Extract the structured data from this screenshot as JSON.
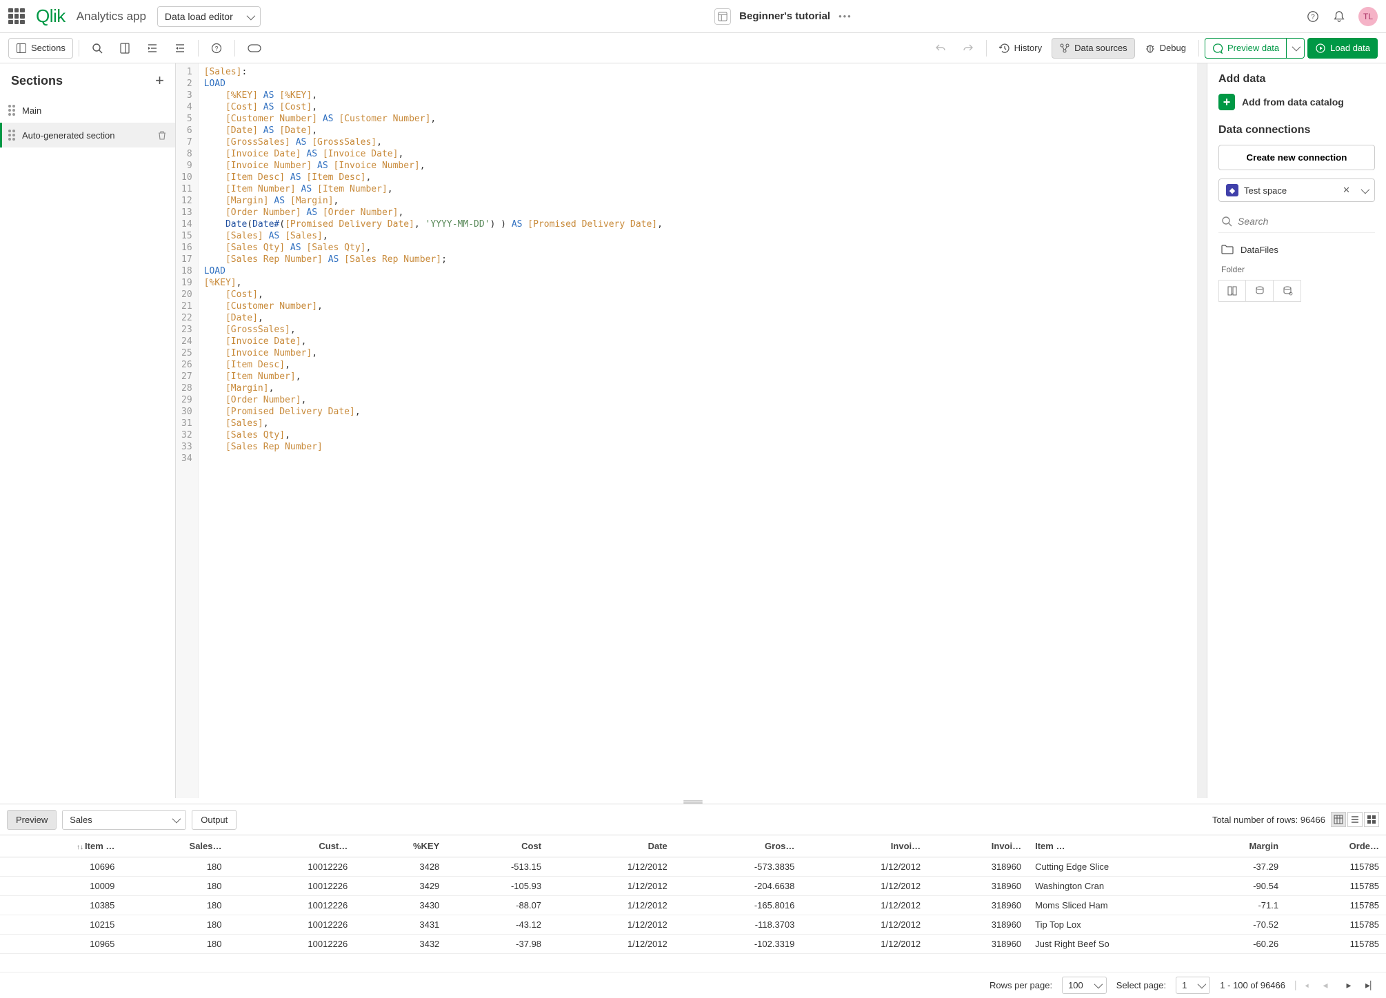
{
  "header": {
    "logo": "Qlik",
    "app_name": "Analytics app",
    "mode": "Data load editor",
    "doc_title": "Beginner's tutorial",
    "avatar_initials": "TL"
  },
  "toolbar": {
    "sections": "Sections",
    "history": "History",
    "data_sources": "Data sources",
    "debug": "Debug",
    "preview_data": "Preview data",
    "load_data": "Load data"
  },
  "sections": {
    "heading": "Sections",
    "items": [
      {
        "label": "Main",
        "selected": false
      },
      {
        "label": "Auto-generated section",
        "selected": true
      }
    ]
  },
  "editor": {
    "lines": [
      {
        "n": 1,
        "html": "<span class='t-orange'>[Sales]</span>:"
      },
      {
        "n": 2,
        "html": "<span class='t-blue'>LOAD</span>"
      },
      {
        "n": 3,
        "html": "    <span class='t-orange'>[%KEY]</span> <span class='t-blue'>AS</span> <span class='t-orange'>[%KEY]</span>,"
      },
      {
        "n": 4,
        "html": "    <span class='t-orange'>[Cost]</span> <span class='t-blue'>AS</span> <span class='t-orange'>[Cost]</span>,"
      },
      {
        "n": 5,
        "html": "    <span class='t-orange'>[Customer Number]</span> <span class='t-blue'>AS</span> <span class='t-orange'>[Customer Number]</span>,"
      },
      {
        "n": 6,
        "html": "    <span class='t-orange'>[Date]</span> <span class='t-blue'>AS</span> <span class='t-orange'>[Date]</span>,"
      },
      {
        "n": 7,
        "html": "    <span class='t-orange'>[GrossSales]</span> <span class='t-blue'>AS</span> <span class='t-orange'>[GrossSales]</span>,"
      },
      {
        "n": 8,
        "html": "    <span class='t-orange'>[Invoice Date]</span> <span class='t-blue'>AS</span> <span class='t-orange'>[Invoice Date]</span>,"
      },
      {
        "n": 9,
        "html": "    <span class='t-orange'>[Invoice Number]</span> <span class='t-blue'>AS</span> <span class='t-orange'>[Invoice Number]</span>,"
      },
      {
        "n": 10,
        "html": "    <span class='t-orange'>[Item Desc]</span> <span class='t-blue'>AS</span> <span class='t-orange'>[Item Desc]</span>,"
      },
      {
        "n": 11,
        "html": "    <span class='t-orange'>[Item Number]</span> <span class='t-blue'>AS</span> <span class='t-orange'>[Item Number]</span>,"
      },
      {
        "n": 12,
        "html": "    <span class='t-orange'>[Margin]</span> <span class='t-blue'>AS</span> <span class='t-orange'>[Margin]</span>,"
      },
      {
        "n": 13,
        "html": "    <span class='t-orange'>[Order Number]</span> <span class='t-blue'>AS</span> <span class='t-orange'>[Order Number]</span>,"
      },
      {
        "n": 14,
        "html": "    <span class='t-darkblue'>Date</span>(<span class='t-darkblue'>Date#</span>(<span class='t-orange'>[Promised Delivery Date]</span>, <span class='t-green'>'YYYY-MM-DD'</span>) ) <span class='t-blue'>AS</span> <span class='t-orange'>[Promised Delivery Date]</span>,"
      },
      {
        "n": 15,
        "html": "    <span class='t-orange'>[Sales]</span> <span class='t-blue'>AS</span> <span class='t-orange'>[Sales]</span>,"
      },
      {
        "n": 16,
        "html": "    <span class='t-orange'>[Sales Qty]</span> <span class='t-blue'>AS</span> <span class='t-orange'>[Sales Qty]</span>,"
      },
      {
        "n": 17,
        "html": "    <span class='t-orange'>[Sales Rep Number]</span> <span class='t-blue'>AS</span> <span class='t-orange'>[Sales Rep Number]</span>;"
      },
      {
        "n": 18,
        "html": "<span class='t-blue'>LOAD</span>"
      },
      {
        "n": 19,
        "html": "<span class='t-orange'>[%KEY]</span>,"
      },
      {
        "n": 20,
        "html": "    <span class='t-orange'>[Cost]</span>,"
      },
      {
        "n": 21,
        "html": "    <span class='t-orange'>[Customer Number]</span>,"
      },
      {
        "n": 22,
        "html": "    <span class='t-orange'>[Date]</span>,"
      },
      {
        "n": 23,
        "html": "    <span class='t-orange'>[GrossSales]</span>,"
      },
      {
        "n": 24,
        "html": "    <span class='t-orange'>[Invoice Date]</span>,"
      },
      {
        "n": 25,
        "html": "    <span class='t-orange'>[Invoice Number]</span>,"
      },
      {
        "n": 26,
        "html": "    <span class='t-orange'>[Item Desc]</span>,"
      },
      {
        "n": 27,
        "html": "    <span class='t-orange'>[Item Number]</span>,"
      },
      {
        "n": 28,
        "html": "    <span class='t-orange'>[Margin]</span>,"
      },
      {
        "n": 29,
        "html": "    <span class='t-orange'>[Order Number]</span>,"
      },
      {
        "n": 30,
        "html": "    <span class='t-orange'>[Promised Delivery Date]</span>,"
      },
      {
        "n": 31,
        "html": "    <span class='t-orange'>[Sales]</span>,"
      },
      {
        "n": 32,
        "html": "    <span class='t-orange'>[Sales Qty]</span>,"
      },
      {
        "n": 33,
        "html": "    <span class='t-orange'>[Sales Rep Number]</span>"
      },
      {
        "n": 34,
        "html": ""
      }
    ]
  },
  "right": {
    "add_data": "Add data",
    "add_catalog": "Add from data catalog",
    "data_connections": "Data connections",
    "create_conn": "Create new connection",
    "space": "Test space",
    "search_placeholder": "Search",
    "datafiles": "DataFiles",
    "folder_label": "Folder"
  },
  "preview": {
    "tab_preview": "Preview",
    "tab_output": "Output",
    "table_select": "Sales",
    "total_rows_label": "Total number of rows: 96466",
    "columns": [
      "Item …",
      "Sales…",
      "Cust…",
      "%KEY",
      "Cost",
      "Date",
      "Gros…",
      "Invoi…",
      "Invoi…",
      "Item …",
      "Margin",
      "Orde…"
    ],
    "rows": [
      [
        "10696",
        "180",
        "10012226",
        "3428",
        "-513.15",
        "1/12/2012",
        "-573.3835",
        "1/12/2012",
        "318960",
        "Cutting Edge Slice",
        "-37.29",
        "115785"
      ],
      [
        "10009",
        "180",
        "10012226",
        "3429",
        "-105.93",
        "1/12/2012",
        "-204.6638",
        "1/12/2012",
        "318960",
        "Washington Cran",
        "-90.54",
        "115785"
      ],
      [
        "10385",
        "180",
        "10012226",
        "3430",
        "-88.07",
        "1/12/2012",
        "-165.8016",
        "1/12/2012",
        "318960",
        "Moms Sliced Ham",
        "-71.1",
        "115785"
      ],
      [
        "10215",
        "180",
        "10012226",
        "3431",
        "-43.12",
        "1/12/2012",
        "-118.3703",
        "1/12/2012",
        "318960",
        "Tip Top Lox",
        "-70.52",
        "115785"
      ],
      [
        "10965",
        "180",
        "10012226",
        "3432",
        "-37.98",
        "1/12/2012",
        "-102.3319",
        "1/12/2012",
        "318960",
        "Just Right Beef So",
        "-60.26",
        "115785"
      ]
    ],
    "rows_per_page_label": "Rows per page:",
    "rows_per_page": "100",
    "select_page_label": "Select page:",
    "select_page": "1",
    "range": "1 - 100 of 96466"
  }
}
